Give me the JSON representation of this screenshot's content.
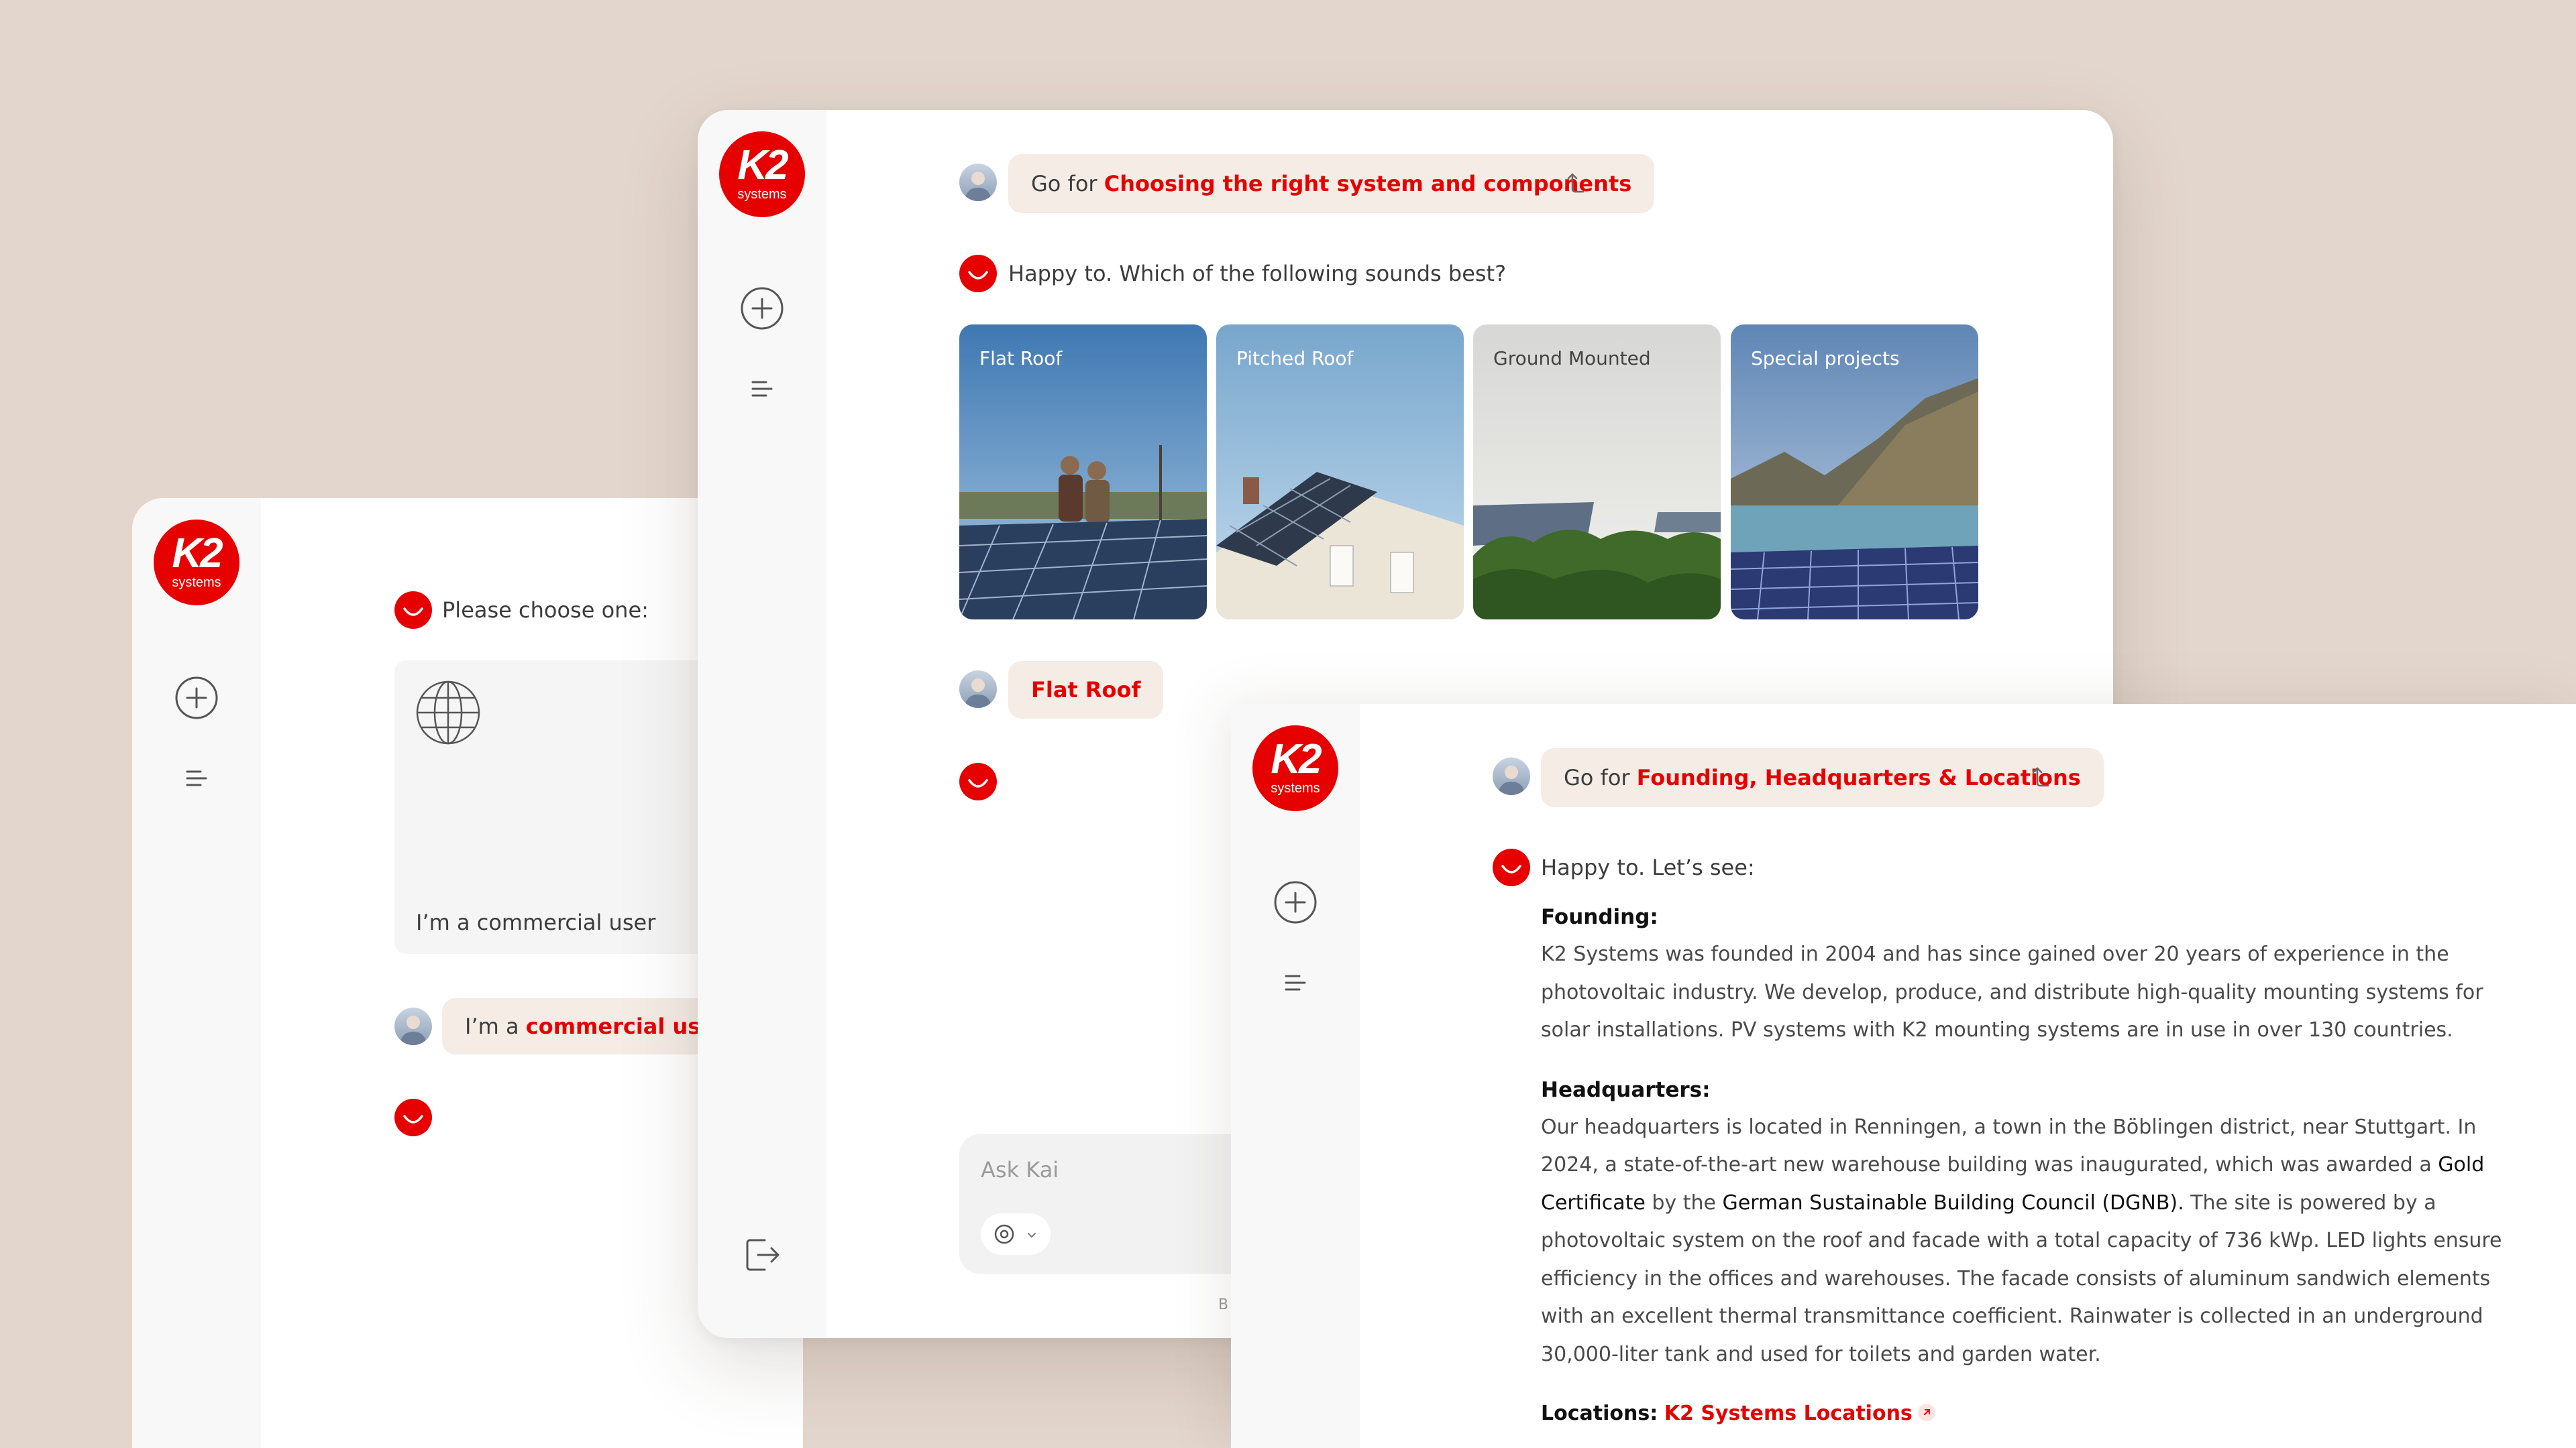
{
  "brand": {
    "logo_text": "K2",
    "logo_sub": "systems",
    "accent": "#e60000",
    "background": "#e3d6cc"
  },
  "window_a": {
    "kai_prompt": "Please choose one:",
    "choice_card": {
      "icon": "globe-icon",
      "label": "I’m a commercial user"
    },
    "user_reply": {
      "prefix": "I’m a ",
      "highlight": "commercial user"
    }
  },
  "window_b": {
    "user_message": {
      "prefix": "Go for ",
      "highlight": "Choosing the right system and components"
    },
    "kai_reply": "Happy to. Which of the following sounds best?",
    "options": [
      {
        "label": "Flat Roof"
      },
      {
        "label": "Pitched Roof"
      },
      {
        "label": "Ground Mounted"
      },
      {
        "label": "Special projects"
      }
    ],
    "user_choice": "Flat Roof",
    "input": {
      "placeholder": "Ask Kai"
    },
    "footer_fragment": "B"
  },
  "window_c": {
    "user_message": {
      "prefix": "Go for ",
      "highlight": "Founding, Headquarters & Locations"
    },
    "kai_reply": "Happy to. Let’s see:",
    "founding_heading": "Founding:",
    "founding_text": "K2 Systems was founded in 2004 and has since gained over 20 years of experience in the photovoltaic industry. We develop, produce, and distribute high-quality mounting systems for solar installations. PV systems with K2 mounting systems are in use in over 130 countries.",
    "hq_heading": "Headquarters:",
    "hq_text_1": "Our headquarters is located in Renningen, a town in the Böblingen district, near Stuttgart. In 2024, a state-of-the-art new warehouse building was inaugurated, which was awarded a ",
    "hq_gold": "Gold Certificate",
    "hq_text_2": " by the ",
    "hq_dgnb": "German Sustainable Building Council (DGNB).",
    "hq_text_3": " The site is powered by a photovoltaic system on the roof and facade with a total capacity of 736 kWp. LED lights ensure efficiency in the offices and warehouses. The facade consists of aluminum sandwich elements with an excellent thermal transmittance coefficient. Rainwater is collected in an underground 30,000-liter tank and used for toilets and garden water.",
    "locations_label": "Locations:",
    "locations_link": "K2 Systems Locations"
  }
}
